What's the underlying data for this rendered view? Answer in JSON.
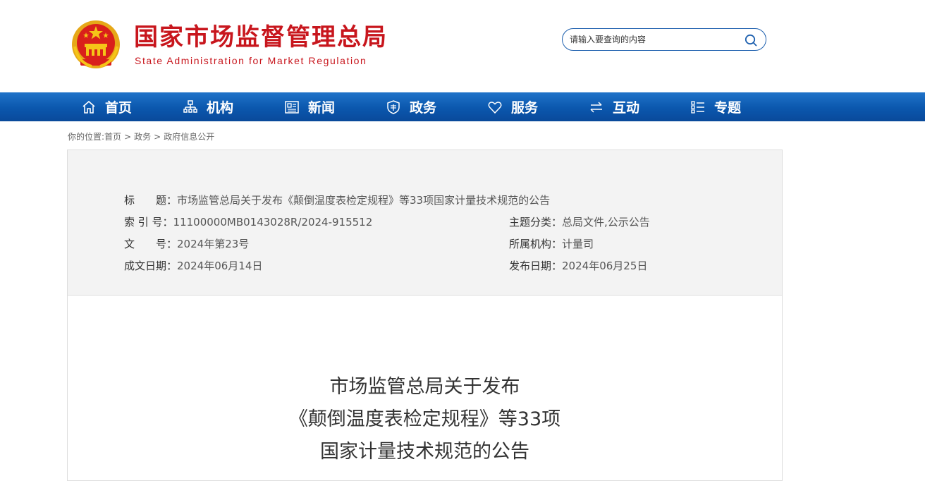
{
  "header": {
    "title_cn": "国家市场监督管理总局",
    "title_en": "State Administration for Market Regulation",
    "search_placeholder": "请输入要查询的内容"
  },
  "nav": {
    "items": [
      {
        "label": "首页",
        "icon": "home-icon"
      },
      {
        "label": "机构",
        "icon": "org-chart-icon"
      },
      {
        "label": "新闻",
        "icon": "news-icon"
      },
      {
        "label": "政务",
        "icon": "shield-icon"
      },
      {
        "label": "服务",
        "icon": "heart-icon"
      },
      {
        "label": "互动",
        "icon": "exchange-arrows-icon"
      },
      {
        "label": "专题",
        "icon": "list-icon"
      }
    ]
  },
  "breadcrumb": {
    "prefix": "你的位置:",
    "items": [
      "首页",
      "政务",
      "政府信息公开"
    ],
    "separator": ">"
  },
  "meta": {
    "title_label": "标　　题：",
    "title_value": "市场监管总局关于发布《颠倒温度表检定规程》等33项国家计量技术规范的公告",
    "index_label": "索 引 号：",
    "index_value": "11100000MB0143028R/2024-915512",
    "topic_label": "主题分类：",
    "topic_value": "总局文件,公示公告",
    "doc_no_label": "文　　号：",
    "doc_no_value": "2024年第23号",
    "org_label": "所属机构：",
    "org_value": "计量司",
    "created_label": "成文日期：",
    "created_value": "2024年06月14日",
    "published_label": "发布日期：",
    "published_value": "2024年06月25日"
  },
  "document": {
    "title_lines": [
      "市场监管总局关于发布",
      "《颠倒温度表检定规程》等33项",
      "国家计量技术规范的公告"
    ]
  },
  "colors": {
    "brand_red": "#c8161d",
    "nav_blue": "#0b57ad",
    "meta_bg": "#f3f3f3"
  }
}
